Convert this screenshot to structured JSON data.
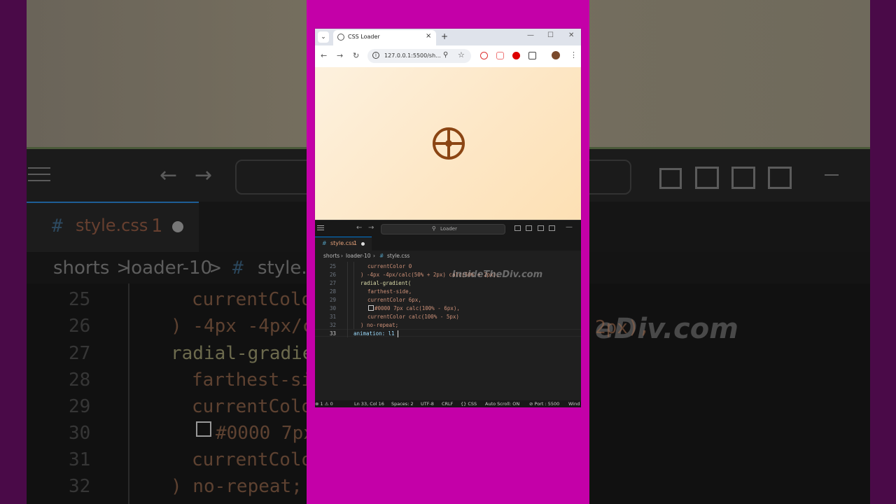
{
  "background": {
    "tab_file": "style.css",
    "tab_hash": "#",
    "tab_err": "1",
    "breadcrumb": [
      "shorts",
      ">",
      "loader-10",
      ">",
      "#",
      "style.c"
    ],
    "line_numbers": [
      "25",
      "26",
      "27",
      "28",
      "29",
      "30",
      "31",
      "32"
    ],
    "lines": [
      "currentColo",
      ") -4px -4px/c",
      "radial-gradie",
      "farthest-si",
      "currentColo",
      "#0000 7px",
      "currentColo",
      ") no-repeat;"
    ],
    "watermark": "eDiv.com",
    "fragment": "2px),"
  },
  "browser": {
    "tab_title": "CSS Loader",
    "tab_close": "×",
    "new_tab": "+",
    "url": "127.0.0.1:5500/sh...",
    "back": "←",
    "forward": "→",
    "reload": "↻",
    "zoom_icon": "⚲",
    "star_icon": "☆",
    "menu_icon": "⋮",
    "minimize": "—",
    "maximize": "☐",
    "close": "✕",
    "loader_color": "#8b4513"
  },
  "vscode": {
    "search_placeholder": "Loader",
    "tab": {
      "hash": "#",
      "name": "style.css",
      "errors": "1"
    },
    "breadcrumb": {
      "folder1": "shorts",
      "folder2": "loader-10",
      "hash": "#",
      "file": "style.css"
    },
    "code_lines": [
      {
        "n": "25",
        "text": "currentColor 0"
      },
      {
        "n": "26",
        "text": ") -4px -4px/calc(50% + 2px) calc(50% + 2px),"
      },
      {
        "n": "27",
        "text": "radial-gradient("
      },
      {
        "n": "28",
        "text": "farthest-side,"
      },
      {
        "n": "29",
        "text": "currentColor 6px,"
      },
      {
        "n": "30",
        "text": "#0000 7px calc(100% - 6px),"
      },
      {
        "n": "31",
        "text": "currentColor calc(100% - 5px)"
      },
      {
        "n": "32",
        "text": ") no-repeat;"
      },
      {
        "n": "33",
        "text": "animation: l1"
      }
    ],
    "watermark": "InsideTheDiv.com",
    "status": {
      "problems": "⊗ 1 ⚠ 0",
      "position": "Ln 33, Col 16",
      "spaces": "Spaces: 2",
      "encoding": "UTF-8",
      "eol": "CRLF",
      "language": "{} CSS",
      "autoscroll": "Auto Scroll: ON",
      "port": "⊘ Port : 5500",
      "extra": "Wind"
    }
  }
}
